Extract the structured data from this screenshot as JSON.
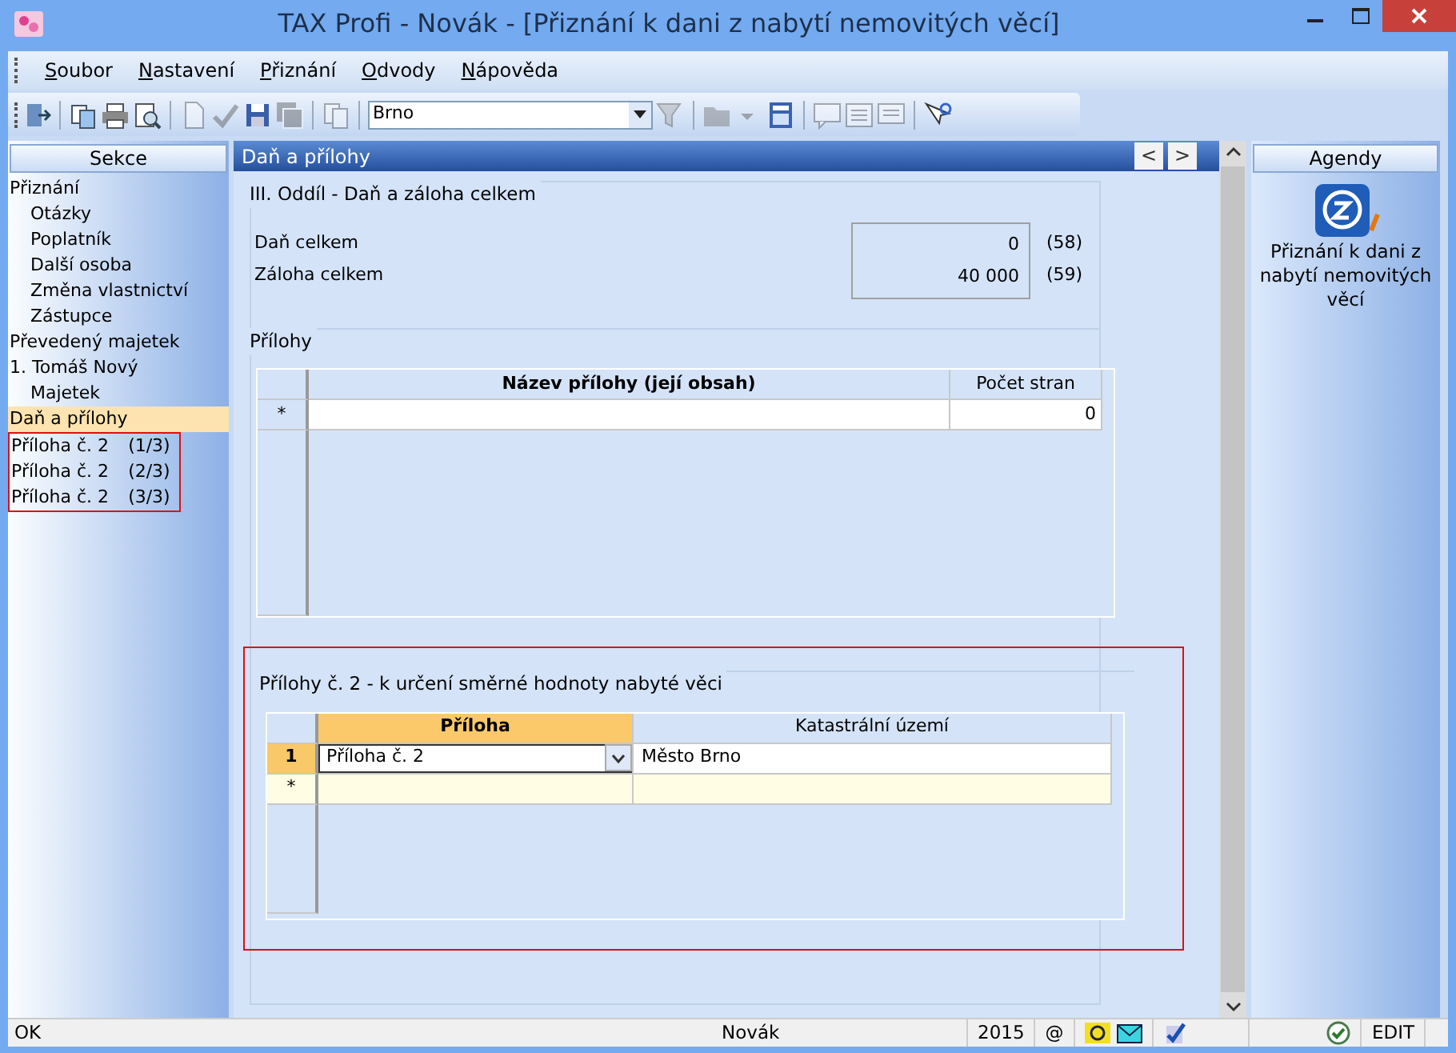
{
  "window": {
    "title": "TAX Profi - Novák - [Přiznání k dani z nabytí nemovitých věcí]"
  },
  "menu": [
    {
      "label": "Soubor"
    },
    {
      "label": "Nastavení"
    },
    {
      "label": "Přiznání"
    },
    {
      "label": "Odvody"
    },
    {
      "label": "Nápověda"
    }
  ],
  "toolbar": [
    {
      "kind": "icon",
      "disabled": false
    },
    {
      "kind": "separator"
    },
    {
      "kind": "icon",
      "disabled": false
    },
    {
      "kind": "icon",
      "disabled": false
    },
    {
      "kind": "icon",
      "disabled": false
    },
    {
      "kind": "separator"
    },
    {
      "kind": "icon",
      "disabled": true
    },
    {
      "kind": "icon",
      "disabled": true
    },
    {
      "kind": "icon",
      "disabled": false
    },
    {
      "kind": "icon",
      "disabled": true
    },
    {
      "kind": "separator"
    },
    {
      "kind": "icon",
      "disabled": true
    },
    {
      "kind": "separator"
    },
    {
      "kind": "combo",
      "value": "Brno"
    },
    {
      "kind": "icon",
      "disabled": true
    },
    {
      "kind": "separator"
    },
    {
      "kind": "icon",
      "disabled": true
    },
    {
      "kind": "icon",
      "disabled": true
    },
    {
      "kind": "icon",
      "disabled": false
    },
    {
      "kind": "separator"
    },
    {
      "kind": "icon",
      "disabled": true
    },
    {
      "kind": "icon",
      "disabled": true
    },
    {
      "kind": "icon",
      "disabled": true
    },
    {
      "kind": "separator"
    },
    {
      "kind": "icon",
      "disabled": false
    }
  ],
  "sidebar": {
    "title": "Sekce",
    "items": [
      {
        "label": "Přiznání",
        "selected": false,
        "marked": false,
        "children": [
          {
            "label": "Otázky",
            "selected": false
          },
          {
            "label": "Poplatník",
            "selected": false
          },
          {
            "label": "Další osoba",
            "selected": false
          },
          {
            "label": "Změna vlastnictví",
            "selected": false
          },
          {
            "label": "Zástupce",
            "selected": false
          }
        ]
      },
      {
        "label": "Převedený majetek",
        "selected": false,
        "marked": false
      },
      {
        "label": "1. Tomáš Nový",
        "selected": false,
        "marked": false,
        "children": [
          {
            "label": "Majetek",
            "selected": false
          }
        ]
      },
      {
        "label": "Daň a přílohy",
        "selected": true,
        "marked": false
      },
      {
        "label": "Příloha č. 2",
        "suffix": "(1/3)",
        "selected": false,
        "marked": true
      },
      {
        "label": "Příloha č. 2",
        "suffix": "(2/3)",
        "selected": false,
        "marked": true
      },
      {
        "label": "Příloha č. 2",
        "suffix": "(3/3)",
        "selected": false,
        "marked": true
      }
    ]
  },
  "content": {
    "title": "Daň a přílohy",
    "nav": [
      "<",
      ">"
    ],
    "section": {
      "title": "III. Oddíl - Daň a záloha celkem",
      "fields": [
        {
          "label": "Daň celkem",
          "value": "0",
          "code": "(58)"
        },
        {
          "label": "Záloha celkem",
          "value": "40 000",
          "code": "(59)"
        }
      ]
    },
    "attachments": {
      "title": "Přílohy",
      "columns": [
        {
          "label": "Název přílohy (její obsah)",
          "emphasized": true
        },
        {
          "label": "Počet stran",
          "emphasized": false
        }
      ],
      "new_row": {
        "marker": "*",
        "pages": "0"
      }
    },
    "appendix": {
      "title": "Přílohy č. 2 - k určení směrné hodnoty nabyté věci",
      "marked": true,
      "columns": [
        {
          "label": "Příloha",
          "selected": true
        },
        {
          "label": "Katastrální území",
          "selected": false
        }
      ],
      "rows": [
        {
          "number": "1",
          "selected": true,
          "cells": [
            "Příloha č. 2",
            "Město Brno"
          ]
        }
      ],
      "new_row_marker": "*"
    }
  },
  "agendy": {
    "title": "Agendy",
    "items": [
      {
        "label": "Přiznání k dani z nabytí nemovitých věcí"
      }
    ]
  },
  "status_bar": {
    "message": "OK",
    "user": "Novák",
    "year": "2015",
    "at": "@",
    "mode": "EDIT"
  }
}
